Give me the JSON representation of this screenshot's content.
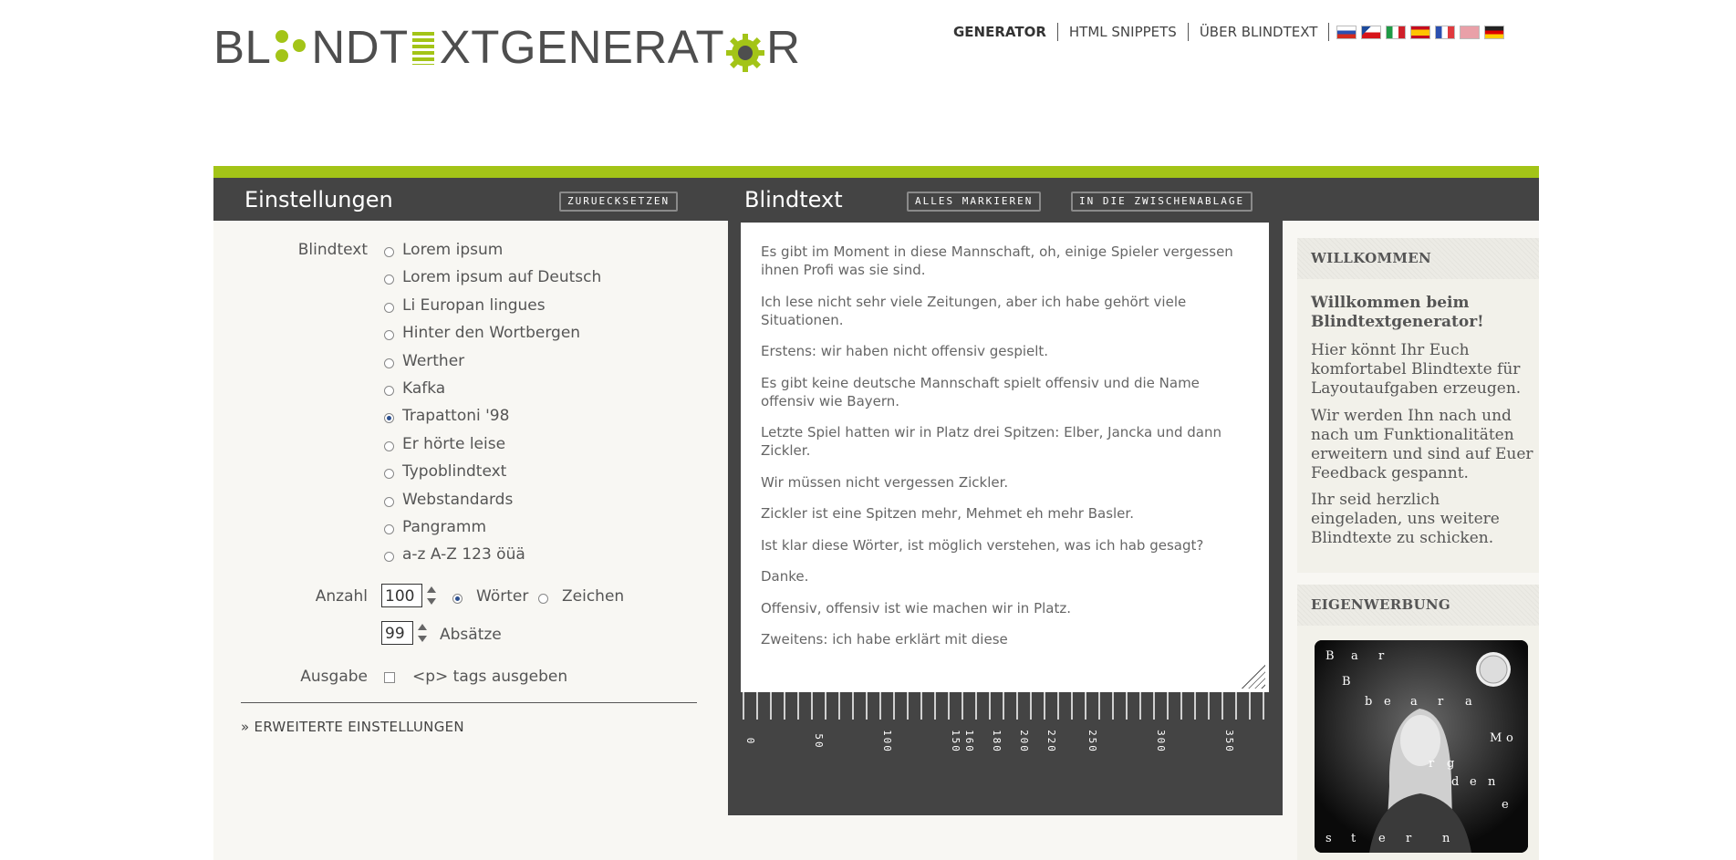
{
  "logo": {
    "part1": "BL",
    "part2": "NDT",
    "part3": "XTGENERAT",
    "part4": "R"
  },
  "nav": {
    "items": [
      {
        "label": "GENERATOR",
        "active": true
      },
      {
        "label": "HTML SNIPPETS",
        "active": false
      },
      {
        "label": "ÜBER BLINDTEXT",
        "active": false
      }
    ],
    "flags": [
      "russian-flag-icon",
      "czech-flag-icon",
      "italian-flag-icon",
      "spanish-flag-icon",
      "french-flag-icon",
      "english-flag-icon",
      "german-flag-icon"
    ]
  },
  "settings": {
    "title": "Einstellungen",
    "reset_label": "ZURUECKSETZEN",
    "blindtext_label": "Blindtext",
    "options": [
      {
        "label": "Lorem ipsum",
        "checked": false
      },
      {
        "label": "Lorem ipsum auf Deutsch",
        "checked": false
      },
      {
        "label": "Li Europan lingues",
        "checked": false
      },
      {
        "label": "Hinter den Wortbergen",
        "checked": false
      },
      {
        "label": "Werther",
        "checked": false
      },
      {
        "label": "Kafka",
        "checked": false
      },
      {
        "label": "Trapattoni '98",
        "checked": true
      },
      {
        "label": "Er hörte leise",
        "checked": false
      },
      {
        "label": "Typoblindtext",
        "checked": false
      },
      {
        "label": "Webstandards",
        "checked": false
      },
      {
        "label": "Pangramm",
        "checked": false
      },
      {
        "label": "a-z A-Z 123 öüä",
        "checked": false
      }
    ],
    "anzahl_label": "Anzahl",
    "count_value": "100",
    "unit_words": "Wörter",
    "unit_chars": "Zeichen",
    "paragraph_value": "99",
    "paragraph_label": "Absätze",
    "ausgabe_label": "Ausgabe",
    "ptags_label": "<p> tags ausgeben",
    "advanced_label": "» ERWEITERTE EINSTELLUNGEN"
  },
  "blindtext": {
    "title": "Blindtext",
    "select_all_label": "ALLES MARKIEREN",
    "clipboard_label": "IN DIE ZWISCHENABLAGE",
    "paragraphs": [
      "Es gibt im Moment in diese Mannschaft, oh, einige Spieler vergessen ihnen Profi was sie sind.",
      "Ich lese nicht sehr viele Zeitungen, aber ich habe gehört viele Situationen.",
      "Erstens: wir haben nicht offensiv gespielt.",
      "Es gibt keine deutsche Mannschaft spielt offensiv und die Name offensiv wie Bayern.",
      "Letzte Spiel hatten wir in Platz drei Spitzen: Elber, Jancka und dann Zickler.",
      "Wir müssen nicht vergessen Zickler.",
      "Zickler ist eine Spitzen mehr, Mehmet eh mehr Basler.",
      "Ist klar diese Wörter, ist möglich verstehen, was ich hab gesagt?",
      "Danke.",
      "Offensiv, offensiv ist wie machen wir in Platz.",
      "Zweitens: ich habe erklärt mit diese"
    ],
    "ruler_labels": [
      "0",
      "50",
      "100",
      "150",
      "160",
      "180",
      "200",
      "220",
      "250",
      "300",
      "350"
    ],
    "ruler_positions": [
      0,
      50,
      100,
      150,
      160,
      180,
      200,
      220,
      250,
      300,
      350
    ]
  },
  "sidebar": {
    "welcome_head": "WILLKOMMEN",
    "welcome_title": "Willkommen beim Blindtextgenerator!",
    "welcome_p1": "Hier könnt Ihr Euch komfortabel Blindtexte für Layoutaufgaben erzeugen.",
    "welcome_p2": "Wir werden Ihn nach und nach um Funktionalitäten erweitern und sind auf Euer Feedback gespannt.",
    "welcome_p3": "Ihr seid herzlich eingeladen, uns weitere Blindtexte zu schicken.",
    "promo_head": "EIGENWERBUNG",
    "promo_letters": [
      "B",
      "a",
      "r",
      "B",
      "b",
      "e",
      "a",
      "r",
      "a",
      "M",
      "o",
      "r",
      "g",
      "d",
      "e",
      "n",
      "e",
      "s",
      "t",
      "e",
      "r",
      "n"
    ]
  },
  "colors": {
    "accent": "#a3c417",
    "dark": "#444444",
    "panel": "#f8f7f3"
  }
}
